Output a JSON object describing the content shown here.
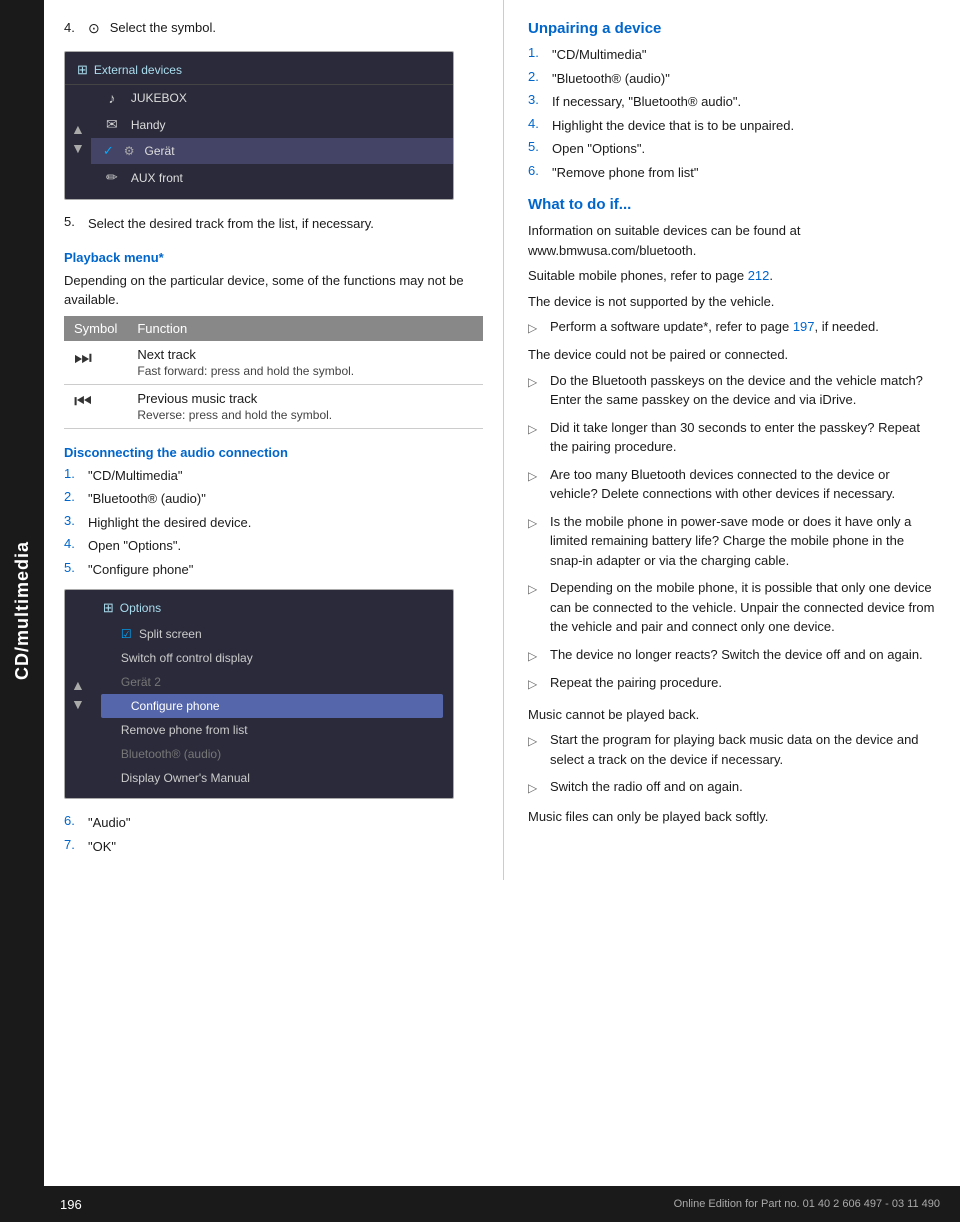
{
  "sidebar": {
    "label": "CD/multimedia"
  },
  "left_col": {
    "step4_label": "4.",
    "step4_text": "Select the symbol.",
    "device_screenshot": {
      "header": "External devices",
      "items": [
        {
          "icon": "♪",
          "label": "JUKEBOX",
          "selected": false
        },
        {
          "icon": "✉",
          "label": "Handy",
          "selected": false
        },
        {
          "icon": "⚙",
          "label": "Gerät",
          "selected": true,
          "checked": true
        },
        {
          "icon": "✏",
          "label": "AUX front",
          "selected": false
        }
      ]
    },
    "step5_num": "5.",
    "step5_text": "Select the desired track from the list, if necessary.",
    "playback_section": "Playback menu*",
    "playback_desc": "Depending on the particular device, some of the functions may not be available.",
    "table": {
      "headers": [
        "Symbol",
        "Function"
      ],
      "rows": [
        {
          "symbol": "⏭",
          "main": "Next track",
          "sub": "Fast forward: press and hold the symbol."
        },
        {
          "symbol": "⏮",
          "main": "Previous music track",
          "sub": "Reverse: press and hold the symbol."
        }
      ]
    },
    "disconnect_section": "Disconnecting the audio connection",
    "disconnect_steps": [
      {
        "num": "1.",
        "text": "\"CD/Multimedia\""
      },
      {
        "num": "2.",
        "text": "\"Bluetooth® (audio)\""
      },
      {
        "num": "3.",
        "text": "Highlight the desired device."
      },
      {
        "num": "4.",
        "text": "Open \"Options\"."
      },
      {
        "num": "5.",
        "text": "\"Configure phone\""
      }
    ],
    "options_screenshot": {
      "header": "Options",
      "items": [
        {
          "label": "Split screen",
          "type": "checkbox",
          "checked": true
        },
        {
          "label": "Switch off control display",
          "type": "normal"
        },
        {
          "label": "Gerät 2",
          "type": "dimmed"
        },
        {
          "label": "Configure phone",
          "type": "highlighted"
        },
        {
          "label": "Remove phone from list",
          "type": "normal"
        },
        {
          "label": "Bluetooth® (audio)",
          "type": "dimmed"
        },
        {
          "label": "Display Owner's Manual",
          "type": "normal"
        }
      ]
    },
    "post_steps": [
      {
        "num": "6.",
        "text": "\"Audio\""
      },
      {
        "num": "7.",
        "text": "\"OK\""
      }
    ]
  },
  "right_col": {
    "unpairing_heading": "Unpairing a device",
    "unpairing_steps": [
      {
        "num": "1.",
        "text": "\"CD/Multimedia\""
      },
      {
        "num": "2.",
        "text": "\"Bluetooth® (audio)\""
      },
      {
        "num": "3.",
        "text": "If necessary, \"Bluetooth® audio\"."
      },
      {
        "num": "4.",
        "text": "Highlight the device that is to be unpaired."
      },
      {
        "num": "5.",
        "text": "Open \"Options\"."
      },
      {
        "num": "6.",
        "text": "\"Remove phone from list\""
      }
    ],
    "what_to_do_heading": "What to do if...",
    "para1": "Information on suitable devices can be found at www.bmwusa.com/bluetooth.",
    "para2_pre": "Suitable mobile phones, refer to page ",
    "para2_link": "212",
    "para2_post": ".",
    "para3": "The device is not supported by the vehicle.",
    "bullets": [
      {
        "arrow": "▷",
        "text_pre": "Perform a software update*, refer to page ",
        "link": "197",
        "text_post": ", if needed."
      }
    ],
    "para4": "The device could not be paired or connected.",
    "bullets2": [
      {
        "arrow": "▷",
        "text": "Do the Bluetooth passkeys on the device and the vehicle match? Enter the same passkey on the device and via iDrive."
      },
      {
        "arrow": "▷",
        "text": "Did it take longer than 30 seconds to enter the passkey? Repeat the pairing procedure."
      },
      {
        "arrow": "▷",
        "text": "Are too many Bluetooth devices connected to the device or vehicle? Delete connections with other devices if necessary."
      },
      {
        "arrow": "▷",
        "text": "Is the mobile phone in power-save mode or does it have only a limited remaining battery life? Charge the mobile phone in the snap-in adapter or via the charging cable."
      },
      {
        "arrow": "▷",
        "text": "Depending on the mobile phone, it is possible that only one device can be connected to the vehicle. Unpair the connected device from the vehicle and pair and connect only one device."
      },
      {
        "arrow": "▷",
        "text": "The device no longer reacts? Switch the device off and on again."
      },
      {
        "arrow": "▷",
        "text": "Repeat the pairing procedure."
      }
    ],
    "para5": "Music cannot be played back.",
    "bullets3": [
      {
        "arrow": "▷",
        "text": "Start the program for playing back music data on the device and select a track on the device if necessary."
      },
      {
        "arrow": "▷",
        "text": "Switch the radio off and on again."
      }
    ],
    "para6": "Music files can only be played back softly."
  },
  "footer": {
    "page_num": "196",
    "footer_text": "Online Edition for Part no. 01 40 2 606 497 - 03 11 490"
  }
}
